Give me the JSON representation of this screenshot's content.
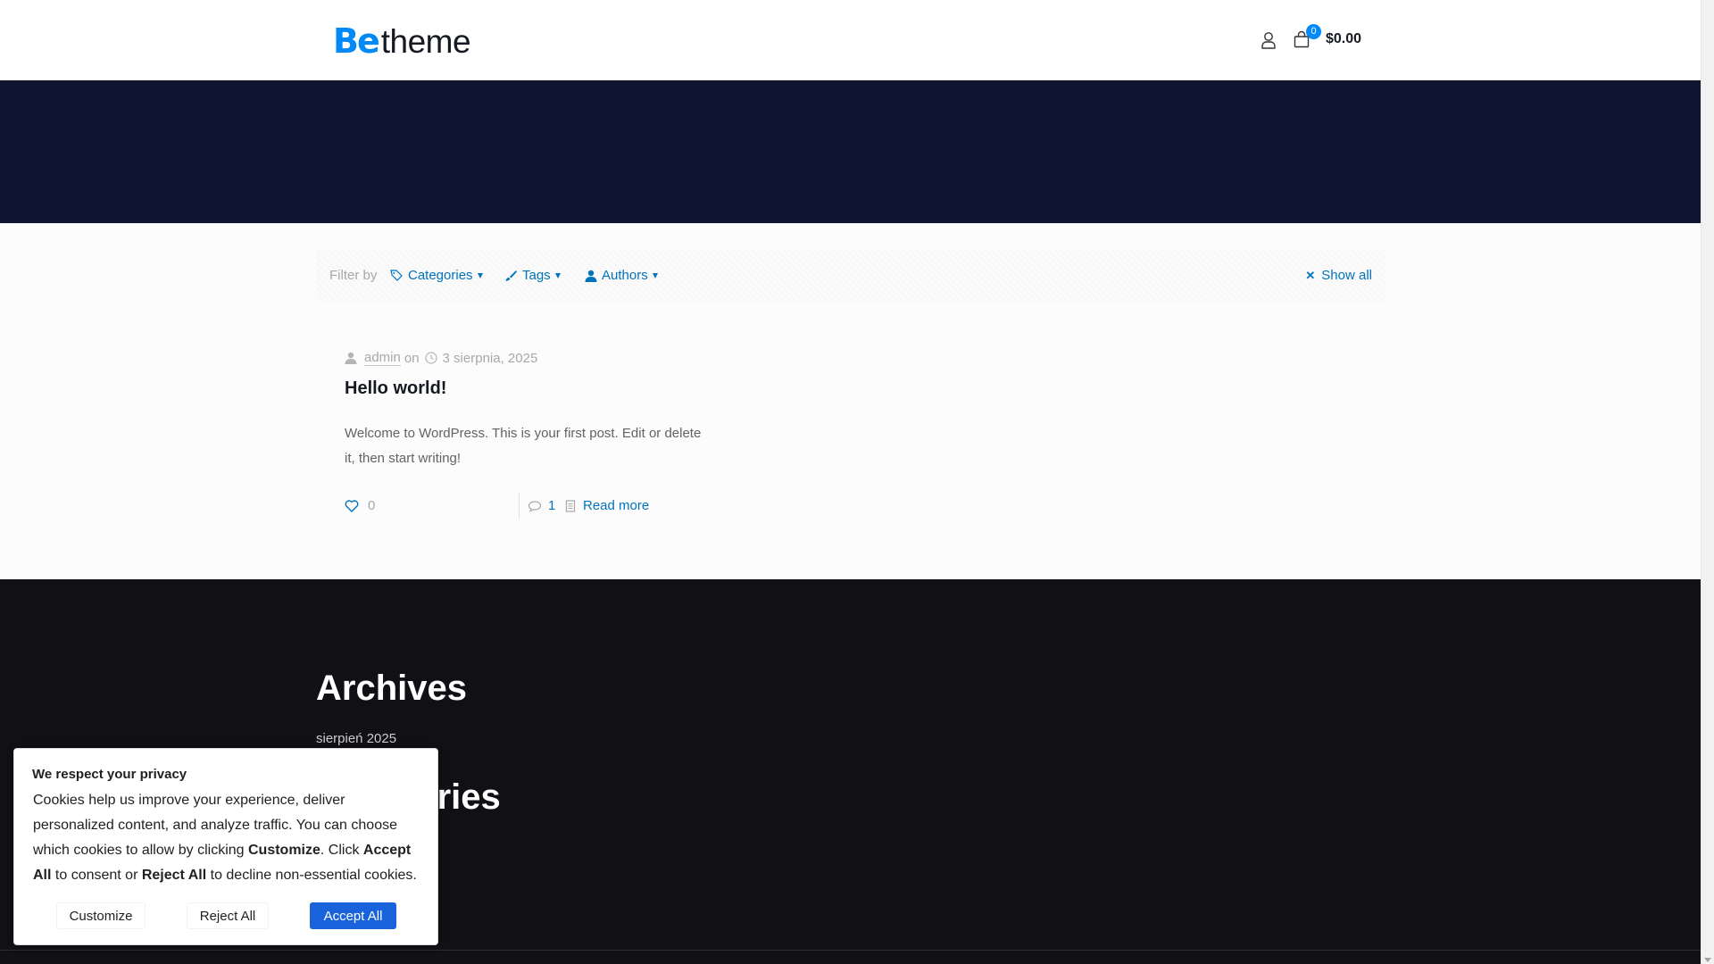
{
  "header": {
    "logo": {
      "be": "Be",
      "theme": "theme"
    },
    "cart": {
      "count": "0",
      "total": "$0.00"
    }
  },
  "filters": {
    "label": "Filter by",
    "items": [
      {
        "label": "Categories",
        "icon": "tag-icon"
      },
      {
        "label": "Tags",
        "icon": "brush-icon"
      },
      {
        "label": "Authors",
        "icon": "person-icon"
      }
    ],
    "show_all": "Show all"
  },
  "post": {
    "author": "admin",
    "on": "on",
    "date": "3 sierpnia, 2025",
    "title": "Hello world!",
    "excerpt": "Welcome to WordPress. This is your first post. Edit or delete it, then start writing!",
    "likes": "0",
    "comments": "1",
    "read_more": "Read more"
  },
  "footer": {
    "archives_title": "Archives",
    "archive_item": "sierpień 2025",
    "categories_title": "Categories"
  },
  "cookie": {
    "title": "We respect your privacy",
    "text_1": "Cookies help us improve your experience, deliver personalized content, and analyze traffic. You can choose which cookies to allow by clicking ",
    "customize_bold": "Customize",
    "text_2": ". Click ",
    "accept_bold": "Accept All",
    "text_3": " to consent or ",
    "reject_bold": "Reject All",
    "text_4": " to decline non-essential cookies.",
    "btn_customize": "Customize",
    "btn_reject": "Reject All",
    "btn_accept": "Accept All"
  },
  "colors": {
    "accent": "#0089f7",
    "link": "#0073bd",
    "hero": "#101532",
    "footer": "#101015",
    "accept_button": "#1863dc"
  }
}
